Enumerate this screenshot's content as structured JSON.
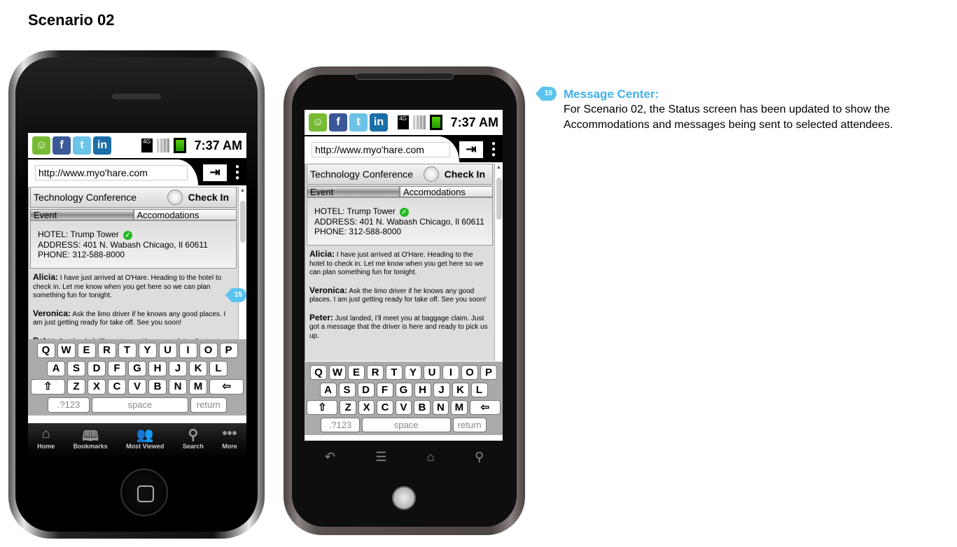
{
  "page_title": "Scenario 02",
  "annotation": {
    "badge": "15",
    "title": "Message Center:",
    "lines": [
      "For Scenario 02, the Status screen has been updated to show the",
      "Accommodations and messages being sent to selected attendees."
    ]
  },
  "status": {
    "time": "7:37 AM",
    "network": "4G",
    "apps": [
      "messaging-icon",
      "facebook-icon",
      "twitter-icon",
      "linkedin-icon"
    ],
    "battery_level": 1.0
  },
  "browser": {
    "url": "http://www.myo'hare.com"
  },
  "event": {
    "title": "Technology Conference",
    "checkin_label": "Check In",
    "tabs": [
      "Event",
      "Accomodations"
    ],
    "hotel": "HOTEL: Trump Tower",
    "address": "ADDRESS: 401 N. Wabash Chicago, Il 60611",
    "phone": "PHONE: 312-588-8000"
  },
  "messages": [
    {
      "sender": "Alicia:",
      "text": "I have just arrived at O'Hare. Heading to the hotel to check in. Let me know when you get here so we can plan something fun for tonight."
    },
    {
      "sender": "Veronica:",
      "text": "Ask the limo driver if he knows any good places. I am just getting ready for take off. See you soon!"
    },
    {
      "sender": "Peter:",
      "text": "Just landed, I'll meet you at baggage claim. Just got a message that the driver is here and ready to pick us up."
    }
  ],
  "keyboard": {
    "rows": [
      [
        "Q",
        "W",
        "E",
        "R",
        "T",
        "Y",
        "U",
        "I",
        "O",
        "P"
      ],
      [
        "A",
        "S",
        "D",
        "F",
        "G",
        "H",
        "J",
        "K",
        "L"
      ],
      [
        "⇧",
        "Z",
        "X",
        "C",
        "V",
        "B",
        "N",
        "M",
        "⇦"
      ]
    ],
    "numbers": ".?123",
    "space": "space",
    "return": "return"
  },
  "iphone_tabbar": [
    {
      "label": "Home",
      "icon": "home-icon"
    },
    {
      "label": "Bookmarks",
      "icon": "book-icon"
    },
    {
      "label": "Most Viewed",
      "icon": "people-icon"
    },
    {
      "label": "Search",
      "icon": "search-icon"
    },
    {
      "label": "More",
      "icon": "more-icon"
    }
  ],
  "android_nav": [
    "back-icon",
    "menu-icon",
    "home-icon",
    "search-icon"
  ],
  "colors": {
    "accent": "#5bc3f0",
    "check": "#22bb22"
  }
}
